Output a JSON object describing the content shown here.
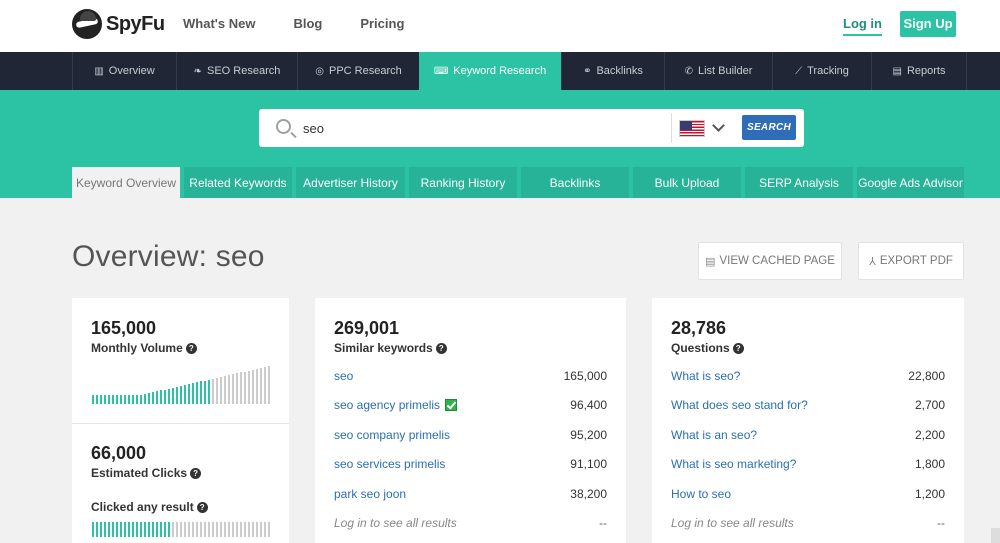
{
  "brand": {
    "name": "SpyFu"
  },
  "topnav": [
    {
      "label": "What's New"
    },
    {
      "label": "Blog"
    },
    {
      "label": "Pricing"
    }
  ],
  "auth": {
    "login": "Log in",
    "signup": "Sign Up"
  },
  "mainnav": [
    {
      "label": "Overview",
      "icon": "bar-chart-icon",
      "glyph": "▥"
    },
    {
      "label": "SEO Research",
      "icon": "leaf-icon",
      "glyph": "❧"
    },
    {
      "label": "PPC Research",
      "icon": "target-icon",
      "glyph": "◎"
    },
    {
      "label": "Keyword Research",
      "icon": "keyboard-icon",
      "glyph": "⌨",
      "active": true
    },
    {
      "label": "Backlinks",
      "icon": "link-icon",
      "glyph": "⚭"
    },
    {
      "label": "List Builder",
      "icon": "megaphone-icon",
      "glyph": "📣"
    },
    {
      "label": "Tracking",
      "icon": "line-chart-icon",
      "glyph": "📈"
    },
    {
      "label": "Reports",
      "icon": "document-icon",
      "glyph": "▤"
    }
  ],
  "search": {
    "value": "seo",
    "country": "United States",
    "button": "SEARCH"
  },
  "subtabs": [
    {
      "label": "Keyword Overview",
      "active": true
    },
    {
      "label": "Related Keywords"
    },
    {
      "label": "Advertiser History"
    },
    {
      "label": "Ranking History"
    },
    {
      "label": "Backlinks"
    },
    {
      "label": "Bulk Upload"
    },
    {
      "label": "SERP Analysis"
    },
    {
      "label": "Google Ads Advisor"
    }
  ],
  "overview": {
    "title": "Overview: seo",
    "cached_button": "VIEW CACHED PAGE",
    "export_button": "EXPORT PDF"
  },
  "volume_card": {
    "monthly_volume": "165,000",
    "monthly_volume_label": "Monthly Volume",
    "estimated_clicks": "66,000",
    "estimated_clicks_label": "Estimated Clicks",
    "clicked_any_label": "Clicked any result"
  },
  "similar_card": {
    "count": "269,001",
    "label": "Similar keywords",
    "rows": [
      {
        "keyword": "seo",
        "value": "165,000"
      },
      {
        "keyword": "seo agency primelis",
        "value": "96,400",
        "checked": true
      },
      {
        "keyword": "seo company primelis",
        "value": "95,200"
      },
      {
        "keyword": "seo services primelis",
        "value": "91,100"
      },
      {
        "keyword": "park seo joon",
        "value": "38,200"
      }
    ],
    "footer": {
      "keyword": "Log in to see all results",
      "value": "--"
    }
  },
  "questions_card": {
    "count": "28,786",
    "label": "Questions",
    "rows": [
      {
        "keyword": "What is seo?",
        "value": "22,800"
      },
      {
        "keyword": "What does seo stand for?",
        "value": "2,700"
      },
      {
        "keyword": "What is an seo?",
        "value": "2,200"
      },
      {
        "keyword": "What is seo marketing?",
        "value": "1,800"
      },
      {
        "keyword": "How to seo",
        "value": "1,200"
      }
    ],
    "footer": {
      "keyword": "Log in to see all results",
      "value": "--"
    }
  },
  "colors": {
    "accent": "#2cc3a5",
    "nav": "#202636",
    "link": "#2a6fb5",
    "search_button": "#2f6db8"
  }
}
